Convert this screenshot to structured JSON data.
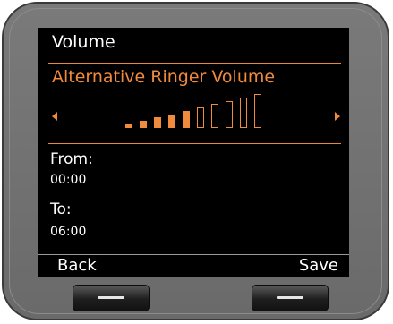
{
  "screen": {
    "title": "Volume",
    "subtitle": "Alternative Ringer Volume",
    "volume": {
      "level": 5,
      "max": 10,
      "left_icon": "arrow-left-icon",
      "right_icon": "arrow-right-icon"
    },
    "from": {
      "label": "From:",
      "value": "00:00"
    },
    "to": {
      "label": "To:",
      "value": "06:00"
    },
    "softkeys": {
      "left": "Back",
      "right": "Save"
    }
  },
  "colors": {
    "accent": "#f08a3c",
    "screen_background": "#000000",
    "text": "#ffffff",
    "bezel": "#6e6e6e"
  }
}
